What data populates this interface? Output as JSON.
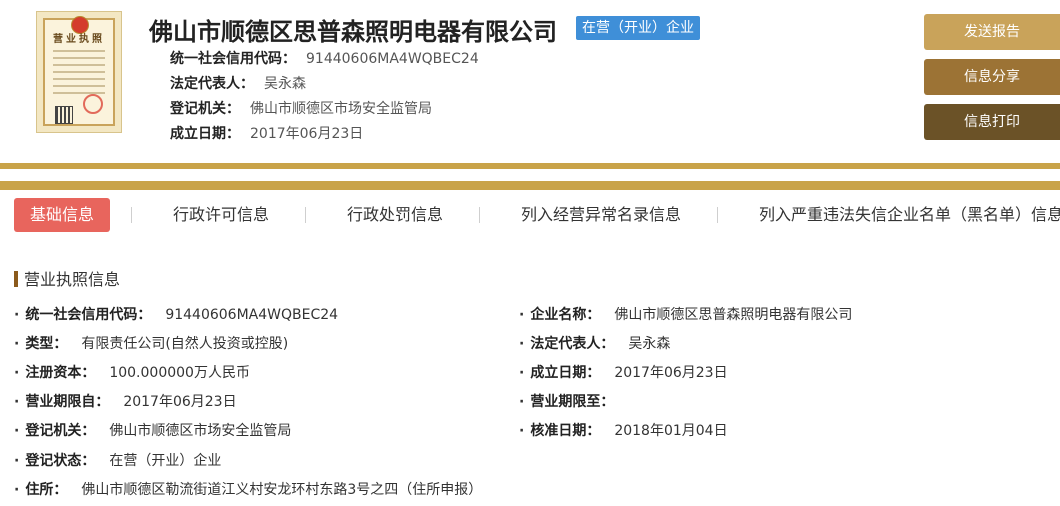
{
  "header": {
    "license_thumb_title": "营业执照",
    "company_name": "佛山市顺德区思普森照明电器有限公司",
    "status_badge": "在营（开业）企业",
    "rows": [
      {
        "label": "统一社会信用代码：",
        "value": "91440606MA4WQBEC24"
      },
      {
        "label": "法定代表人：",
        "value": "吴永森"
      },
      {
        "label": "登记机关：",
        "value": "佛山市顺德区市场安全监管局"
      },
      {
        "label": "成立日期：",
        "value": "2017年06月23日"
      }
    ],
    "actions": {
      "report": "发送报告",
      "share": "信息分享",
      "print": "信息打印"
    }
  },
  "tabs": [
    "基础信息",
    "行政许可信息",
    "行政处罚信息",
    "列入经营异常名录信息",
    "列入严重违法失信企业名单（黑名单）信息"
  ],
  "section": {
    "title": "营业执照信息",
    "left": [
      {
        "label": "统一社会信用代码：",
        "value": "91440606MA4WQBEC24"
      },
      {
        "label": "类型：",
        "value": "有限责任公司(自然人投资或控股)"
      },
      {
        "label": "注册资本：",
        "value": "100.000000万人民币"
      },
      {
        "label": "营业期限自：",
        "value": "2017年06月23日"
      },
      {
        "label": "登记机关：",
        "value": "佛山市顺德区市场安全监管局"
      },
      {
        "label": "登记状态：",
        "value": "在营（开业）企业"
      },
      {
        "label": "住所：",
        "value": "佛山市顺德区勒流街道江义村安龙环村东路3号之四（住所申报）"
      }
    ],
    "right": [
      {
        "label": "企业名称：",
        "value": "佛山市顺德区思普森照明电器有限公司"
      },
      {
        "label": "法定代表人：",
        "value": "吴永森"
      },
      {
        "label": "成立日期：",
        "value": "2017年06月23日"
      },
      {
        "label": "营业期限至：",
        "value": ""
      },
      {
        "label": "核准日期：",
        "value": "2018年01月04日"
      }
    ]
  },
  "colors": {
    "gold_bar": "#c9a349",
    "active_tab": "#e8655d",
    "status_badge": "#3f8fd8",
    "btn_report": "#c9a35a",
    "btn_share": "#9c7335",
    "btn_print": "#6b5227"
  }
}
